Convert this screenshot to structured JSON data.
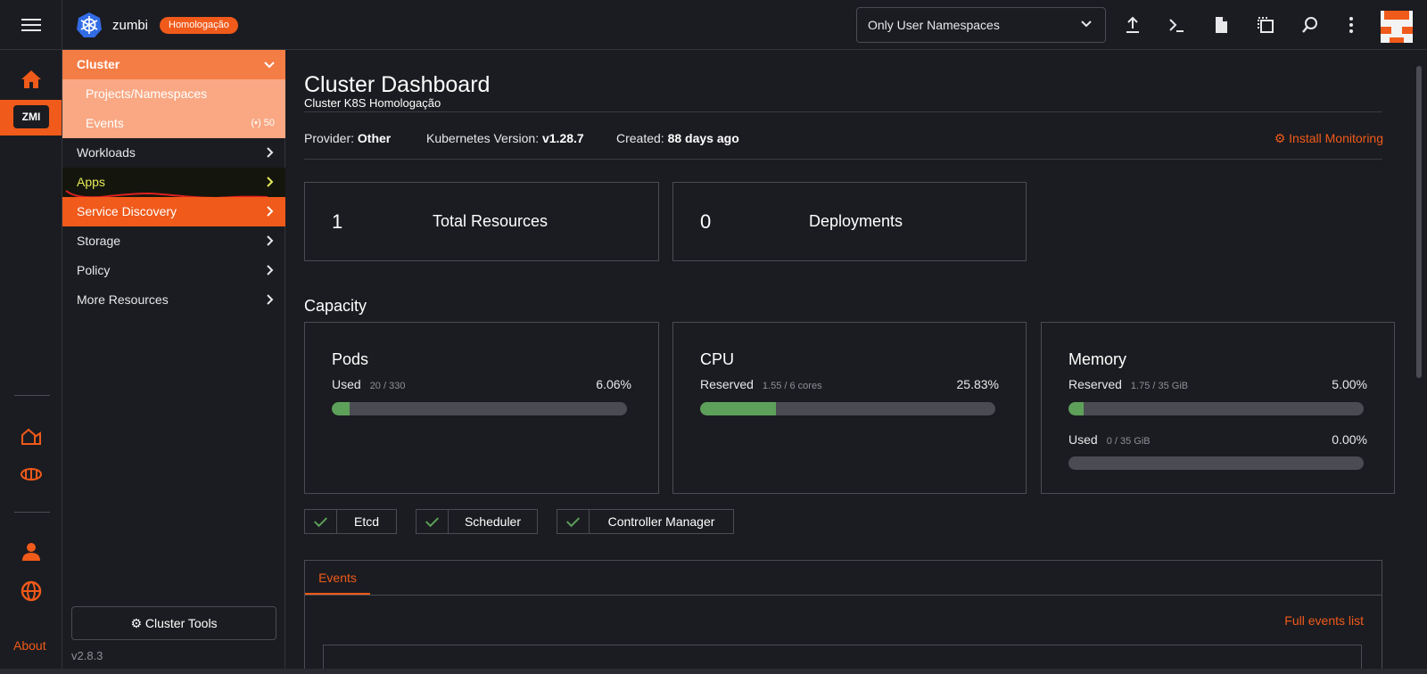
{
  "header": {
    "cluster_name": "zumbi",
    "env_badge": "Homologação",
    "namespace_filter": "Only User Namespaces"
  },
  "rail": {
    "cluster_chip": "ZMI",
    "about": "About"
  },
  "sidenav": {
    "cluster": "Cluster",
    "projects": "Projects/Namespaces",
    "events": "Events",
    "events_count": "50",
    "workloads": "Workloads",
    "apps": "Apps",
    "service_discovery": "Service Discovery",
    "storage": "Storage",
    "policy": "Policy",
    "more_resources": "More Resources",
    "cluster_tools": "Cluster Tools",
    "version": "v2.8.3"
  },
  "dashboard": {
    "title": "Cluster Dashboard",
    "subtitle": "Cluster K8S Homologação",
    "provider_label": "Provider:",
    "provider_value": "Other",
    "k8s_label": "Kubernetes Version:",
    "k8s_value": "v1.28.7",
    "created_label": "Created:",
    "created_value": "88 days ago",
    "install_monitoring": "Install Monitoring",
    "total_resources_count": "1",
    "total_resources_label": "Total Resources",
    "deployments_count": "0",
    "deployments_label": "Deployments",
    "capacity_title": "Capacity"
  },
  "capacity": {
    "pods": {
      "title": "Pods",
      "label": "Used",
      "detail": "20 / 330",
      "pct": "6.06%",
      "fraction": 0.0606
    },
    "cpu": {
      "title": "CPU",
      "label": "Reserved",
      "detail": "1.55 / 6 cores",
      "pct": "25.83%",
      "fraction": 0.2583
    },
    "memory": {
      "title": "Memory",
      "reserved": {
        "label": "Reserved",
        "detail": "1.75 / 35 GiB",
        "pct": "5.00%",
        "fraction": 0.05
      },
      "used": {
        "label": "Used",
        "detail": "0 / 35 GiB",
        "pct": "0.00%",
        "fraction": 0.0
      }
    }
  },
  "components": {
    "etcd": "Etcd",
    "scheduler": "Scheduler",
    "controller_manager": "Controller Manager"
  },
  "events_section": {
    "tab": "Events",
    "full_list": "Full events list"
  },
  "colors": {
    "accent": "#f05a1a",
    "bar_fill": "#5da05a",
    "background": "#1b1c21"
  }
}
